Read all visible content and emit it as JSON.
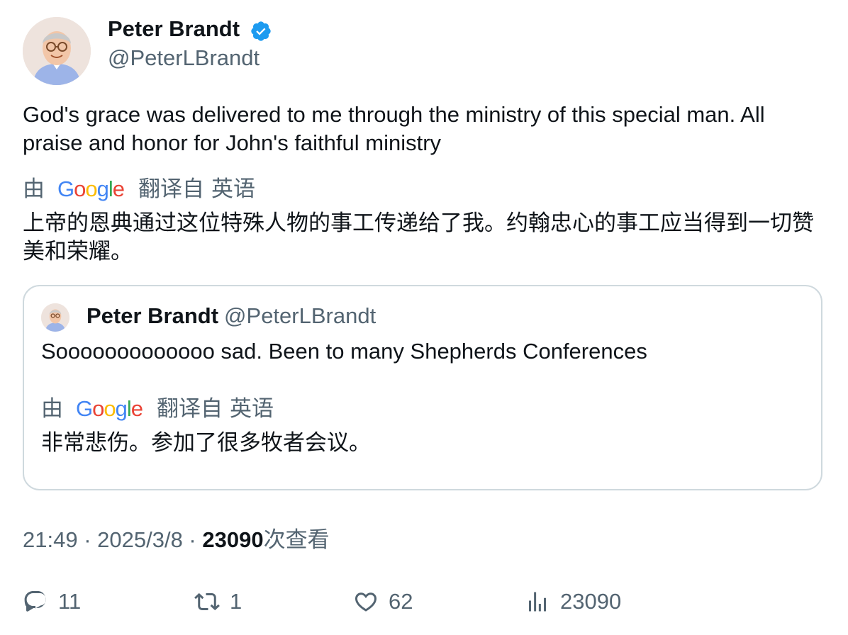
{
  "author": {
    "name": "Peter Brandt",
    "handle": "@PeterLBrandt",
    "verified": true
  },
  "tweet": {
    "text": "God's grace was delivered to me through the ministry of this special man. All praise and honor for John's faithful ministry",
    "translation": {
      "by_label": "由",
      "provider": "Google",
      "from_label": "翻译自",
      "language": "英语",
      "text": "上帝的恩典通过这位特殊人物的事工传递给了我。约翰忠心的事工应当得到一切赞美和荣耀。"
    }
  },
  "quote": {
    "name": "Peter Brandt",
    "handle": "@PeterLBrandt",
    "text": "Sooooooooooooo sad. Been to many Shepherds Conferences",
    "translation": {
      "by_label": "由",
      "provider": "Google",
      "from_label": "翻译自",
      "language": "英语",
      "text": "非常悲伤。参加了很多牧者会议。"
    }
  },
  "meta": {
    "time": "21:49",
    "separator": " · ",
    "date": "2025/3/8",
    "views_count": "23090",
    "views_label": "次查看"
  },
  "actions": {
    "replies": "11",
    "reposts": "1",
    "likes": "62",
    "views": "23090"
  },
  "colors": {
    "verified": "#1d9bf0",
    "secondary_text": "#536471",
    "border": "#cfd9de"
  },
  "icons": [
    "verified-badge-icon",
    "google-logo",
    "reply-icon",
    "repost-icon",
    "like-icon",
    "views-icon"
  ]
}
